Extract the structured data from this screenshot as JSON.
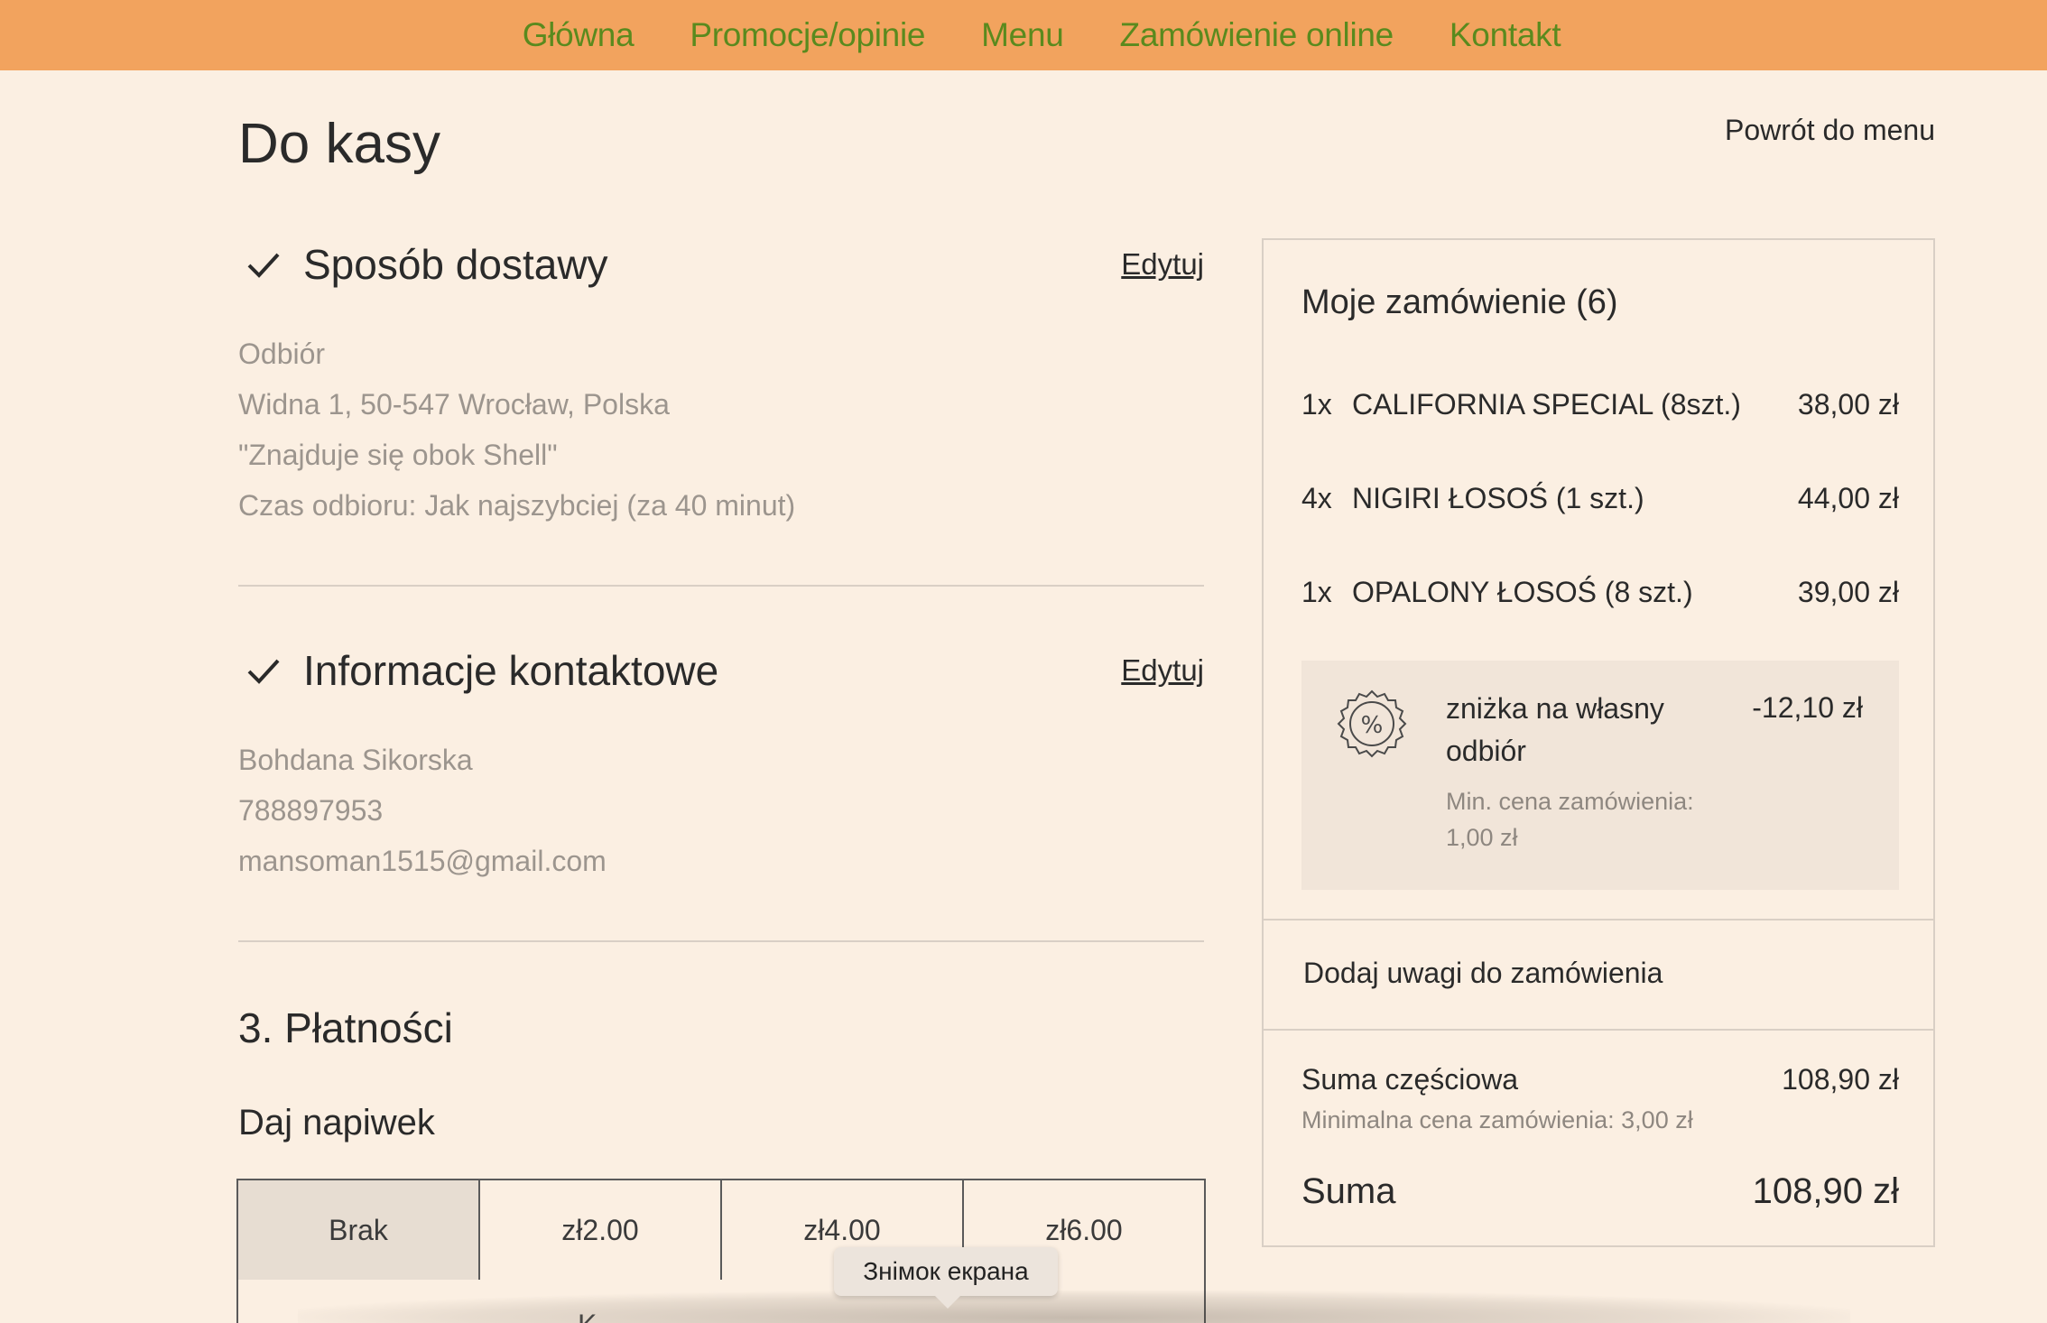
{
  "nav": {
    "items": [
      "Główna",
      "Promocje/opinie",
      "Menu",
      "Zamówienie online",
      "Kontakt"
    ],
    "text_color": "#5a8a1e",
    "bg_color": "#f2a35e"
  },
  "page": {
    "title": "Do kasy",
    "back_link": "Powrót do menu"
  },
  "delivery": {
    "title": "Sposób dostawy",
    "edit": "Edytuj",
    "lines": [
      "Odbiór",
      "Widna 1, 50-547 Wrocław, Polska",
      "\"Znajduje się obok Shell\"",
      "Czas odbioru: Jak najszybciej (za 40 minut)"
    ]
  },
  "contact": {
    "title": "Informacje kontaktowe",
    "edit": "Edytuj",
    "lines": [
      "Bohdana Sikorska",
      "788897953",
      "mansoman1515@gmail.com"
    ]
  },
  "payments": {
    "title": "3. Płatności",
    "tip_title": "Daj napiwek",
    "tip_options": [
      "Brak",
      "zł2.00",
      "zł4.00",
      "zł6.00"
    ],
    "selected_tip": "Brak",
    "below_text": "K"
  },
  "tooltip": {
    "text": "Знімок екрана"
  },
  "order": {
    "title": "Moje zamówienie (6)",
    "items": [
      {
        "qty": "1x",
        "name": "CALIFORNIA SPECIAL (8szt.)",
        "price": "38,00 zł"
      },
      {
        "qty": "4x",
        "name": "NIGIRI ŁOSOŚ (1 szt.)",
        "price": "44,00 zł"
      },
      {
        "qty": "1x",
        "name": "OPALONY ŁOSOŚ (8 szt.)",
        "price": "39,00 zł"
      }
    ],
    "discount": {
      "name": "zniżka na własny odbiór",
      "amount": "-12,10 zł",
      "min": "Min. cena zamówienia: 1,00 zł",
      "icon": "percent-badge-icon"
    },
    "notes_link": "Dodaj uwagi do zamówienia",
    "subtotal_label": "Suma częściowa",
    "subtotal_value": "108,90 zł",
    "min_price": "Minimalna cena zamówienia: 3,00 zł",
    "total_label": "Suma",
    "total_value": "108,90 zł"
  }
}
